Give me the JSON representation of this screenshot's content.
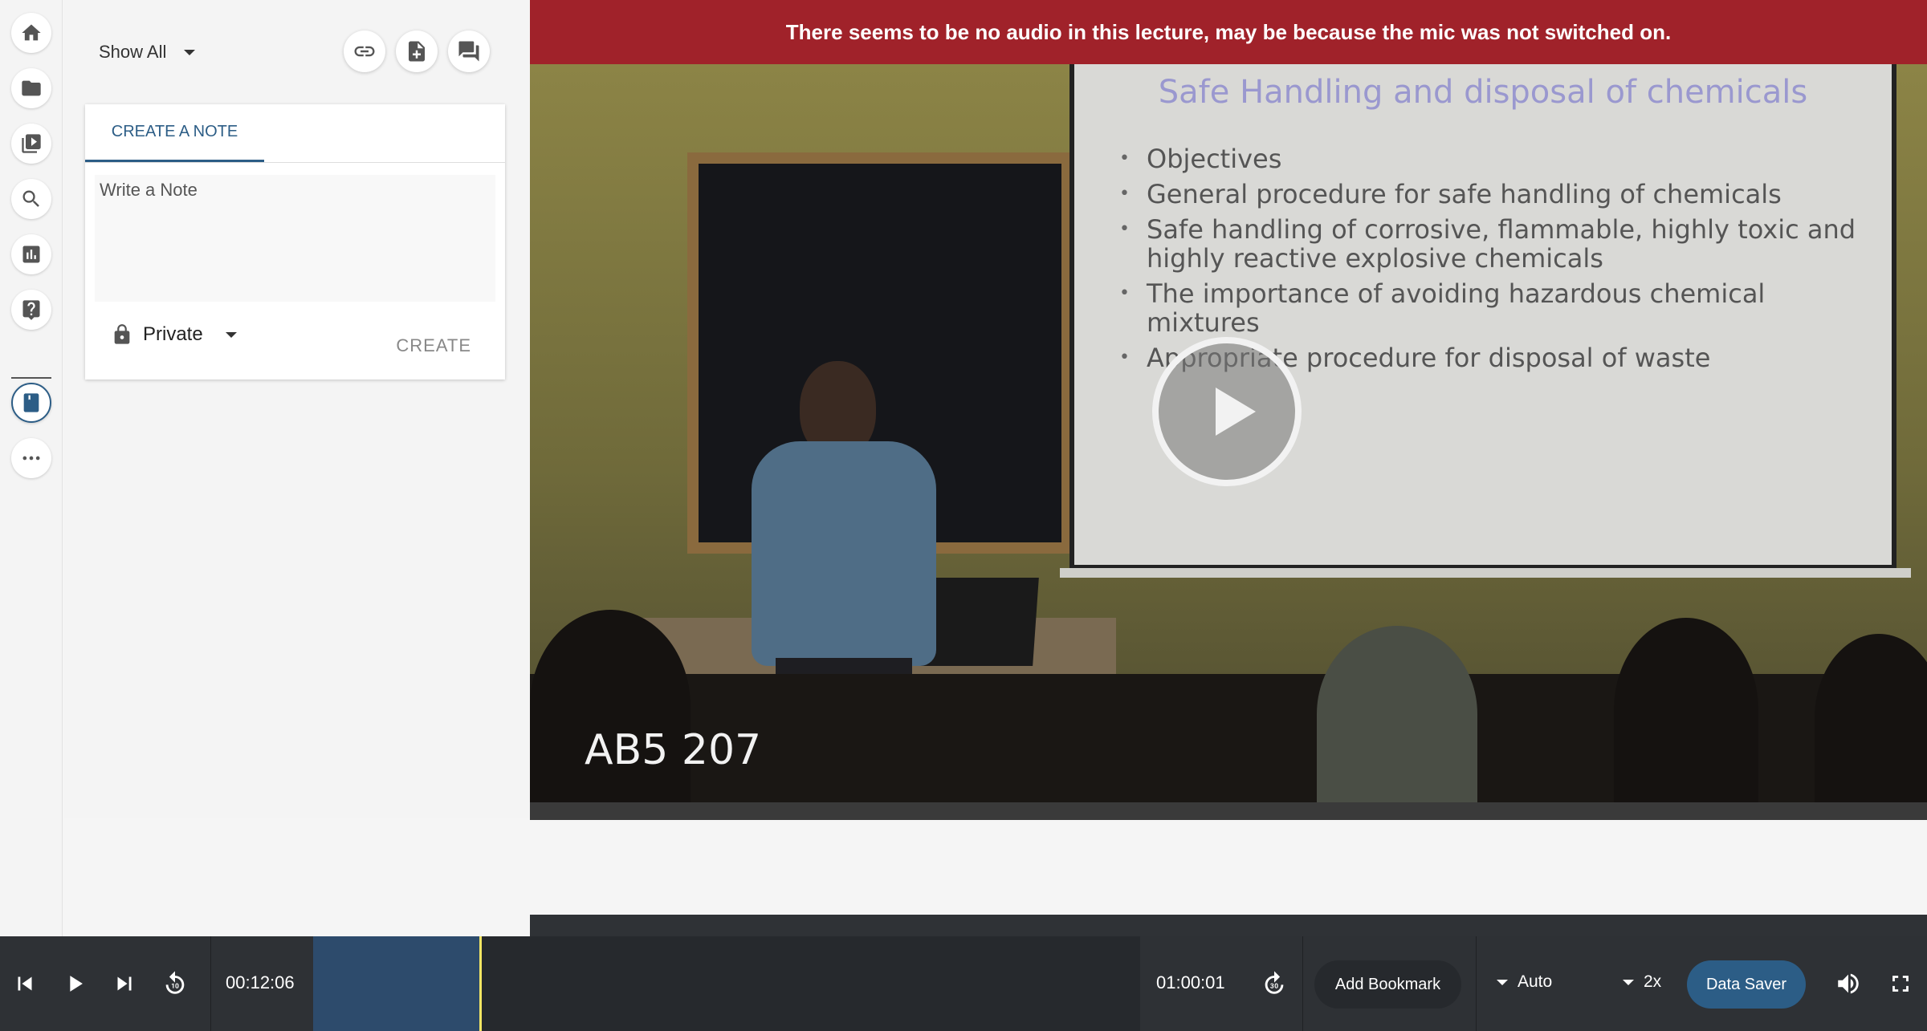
{
  "notes_panel": {
    "filter_label": "Show All",
    "tab_label": "CREATE A NOTE",
    "note_placeholder": "Write a Note",
    "privacy_label": "Private",
    "create_label": "CREATE"
  },
  "rail": {
    "icons": [
      "home-icon",
      "folder-icon",
      "playlist-icon",
      "search-icon",
      "analytics-icon",
      "help-icon",
      "notes-icon",
      "more-icon"
    ]
  },
  "header_actions": [
    "link-icon",
    "add-file-icon",
    "forum-icon"
  ],
  "video": {
    "banner_text": "There seems to be no audio in this lecture, may be because the mic was not switched on.",
    "slide_title": "Safe Handling and disposal of chemicals",
    "slide_bullets": [
      "Objectives",
      "General procedure for safe handling of chemicals",
      "Safe handling of corrosive, flammable, highly toxic and highly reactive  explosive chemicals",
      "The  importance  of  avoiding  hazardous  chemical mixtures",
      "Appropriate procedure for disposal of waste"
    ],
    "room_label": "AB5 207"
  },
  "player": {
    "current_time": "00:12:06",
    "duration": "01:00:01",
    "progress_fraction": 0.201,
    "bookmark_label": "Add Bookmark",
    "quality_value": "Auto",
    "speed_value": "2x",
    "data_saver_label": "Data Saver",
    "colors": {
      "accent": "#2c5d86",
      "banner": "#a0222a",
      "playhead": "#f5e663"
    }
  }
}
